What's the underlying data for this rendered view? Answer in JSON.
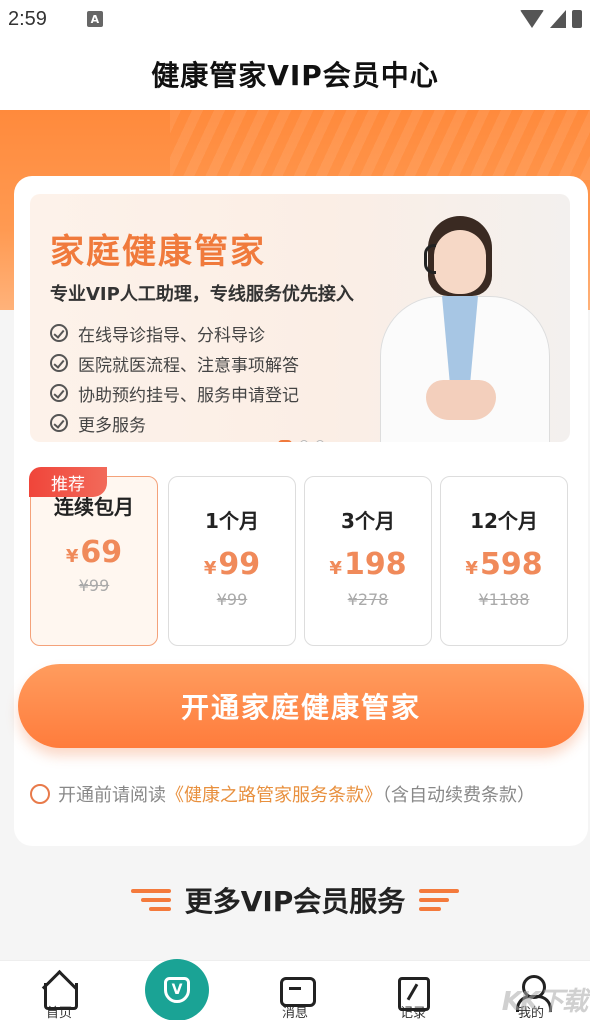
{
  "status_bar": {
    "time": "2:59",
    "notification_icon": "A"
  },
  "header": {
    "title": "健康管家VIP会员中心"
  },
  "banner": {
    "title": "家庭健康管家",
    "subtitle": "专业VIP人工助理，专线服务优先接入",
    "features": [
      "在线导诊指导、分科导诊",
      "医院就医流程、注意事项解答",
      "协助预约挂号、服务申请登记",
      "更多服务"
    ],
    "pager_dots": 3,
    "pager_active": 0
  },
  "plans": [
    {
      "name": "连续包月",
      "price": "69",
      "original": "¥99",
      "badge": "推荐",
      "selected": true
    },
    {
      "name": "1个月",
      "price": "99",
      "original": "¥99",
      "selected": false
    },
    {
      "name": "3个月",
      "price": "198",
      "original": "¥278",
      "selected": false
    },
    {
      "name": "12个月",
      "price": "598",
      "original": "¥1188",
      "selected": false
    }
  ],
  "currency_symbol": "¥",
  "cta": {
    "label": "开通家庭健康管家"
  },
  "agreement": {
    "prefix": "开通前请阅读",
    "link": "《健康之路管家服务条款》",
    "suffix": "（含自动续费条款）"
  },
  "more_section": {
    "title": "更多VIP会员服务"
  },
  "bottom_nav": {
    "items": [
      {
        "label": "首页",
        "icon": "home-icon"
      },
      {
        "label": "",
        "icon": "vip-shield-icon"
      },
      {
        "label": "消息",
        "icon": "message-icon"
      },
      {
        "label": "记录",
        "icon": "record-icon"
      },
      {
        "label": "我的",
        "icon": "profile-icon"
      }
    ]
  },
  "watermark": "KK下载",
  "colors": {
    "accent": "#ff8a3c",
    "price": "#f08a5a",
    "badge": "#f0453a",
    "link": "#e8903e",
    "vip_tab": "#1aa395"
  }
}
